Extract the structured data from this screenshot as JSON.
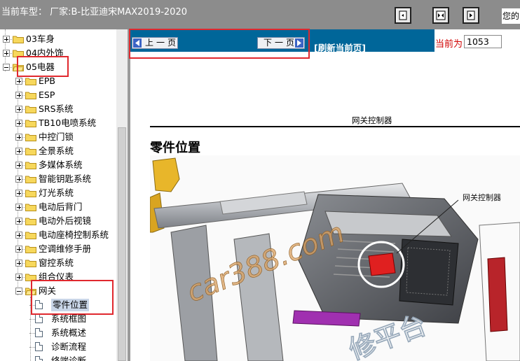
{
  "header": {
    "title": "当前车型：  厂家:B-比亚迪宋MAX2019-2020",
    "welcome": "您的"
  },
  "toolbar": {
    "buttons": [
      {
        "icon": "page-single-icon"
      },
      {
        "icon": "page-double-icon"
      },
      {
        "icon": "page-fit-icon"
      }
    ]
  },
  "tree": {
    "items": [
      {
        "label": "03车身",
        "level": 0,
        "type": "folder",
        "expanded": false
      },
      {
        "label": "04内外饰",
        "level": 0,
        "type": "folder",
        "expanded": false
      },
      {
        "label": "05电器",
        "level": 0,
        "type": "folder",
        "expanded": true
      },
      {
        "label": "EPB",
        "level": 1,
        "type": "folder",
        "expanded": false
      },
      {
        "label": "ESP",
        "level": 1,
        "type": "folder",
        "expanded": false
      },
      {
        "label": "SRS系统",
        "level": 1,
        "type": "folder",
        "expanded": false
      },
      {
        "label": "TB10电喷系统",
        "level": 1,
        "type": "folder",
        "expanded": false
      },
      {
        "label": "中控门锁",
        "level": 1,
        "type": "folder",
        "expanded": false
      },
      {
        "label": "全景系统",
        "level": 1,
        "type": "folder",
        "expanded": false
      },
      {
        "label": "多媒体系统",
        "level": 1,
        "type": "folder",
        "expanded": false
      },
      {
        "label": "智能钥匙系统",
        "level": 1,
        "type": "folder",
        "expanded": false
      },
      {
        "label": "灯光系统",
        "level": 1,
        "type": "folder",
        "expanded": false
      },
      {
        "label": "电动后背门",
        "level": 1,
        "type": "folder",
        "expanded": false
      },
      {
        "label": "电动外后视镜",
        "level": 1,
        "type": "folder",
        "expanded": false
      },
      {
        "label": "电动座椅控制系统",
        "level": 1,
        "type": "folder",
        "expanded": false
      },
      {
        "label": "空调维修手册",
        "level": 1,
        "type": "folder",
        "expanded": false
      },
      {
        "label": "窗控系统",
        "level": 1,
        "type": "folder",
        "expanded": false
      },
      {
        "label": "组合仪表",
        "level": 1,
        "type": "folder",
        "expanded": false
      },
      {
        "label": "网关",
        "level": 1,
        "type": "folder",
        "expanded": true
      },
      {
        "label": "零件位置",
        "level": 2,
        "type": "doc",
        "selected": true
      },
      {
        "label": "系统框图",
        "level": 2,
        "type": "doc"
      },
      {
        "label": "系统概述",
        "level": 2,
        "type": "doc"
      },
      {
        "label": "诊断流程",
        "level": 2,
        "type": "doc"
      },
      {
        "label": "终端诊断",
        "level": 2,
        "type": "doc"
      }
    ]
  },
  "nav": {
    "prev_label": "上一页",
    "next_label": "下一页",
    "refresh_label": "[刷新当前页]",
    "current_label": "当前为",
    "current_page": "1053"
  },
  "doc": {
    "page_title": "网关控制器",
    "section_heading": "零件位置",
    "callout_label": "网关控制器",
    "watermark_main": "car388.com",
    "watermark_bottom": "修平台"
  },
  "colors": {
    "topbar": "#8c8c8c",
    "navbar": "#006699",
    "highlight_box": "#e0282e",
    "current_label": "#d00000"
  }
}
